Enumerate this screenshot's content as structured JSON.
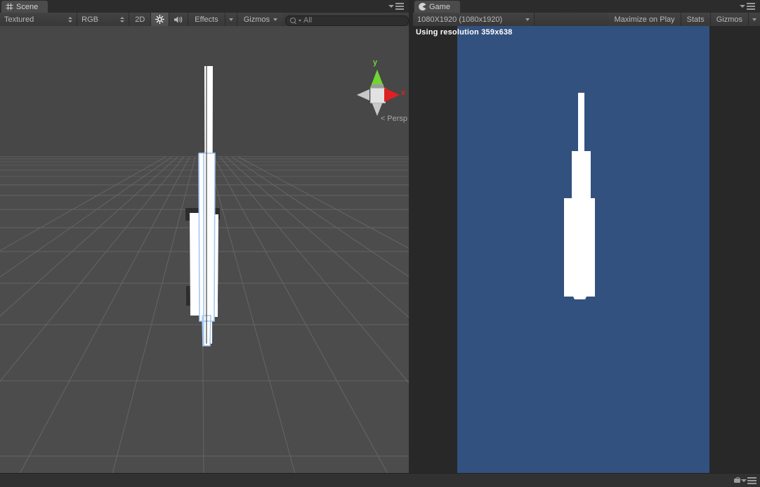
{
  "scene_panel": {
    "tab_label": "Scene",
    "tab_icon": "scene-grid-icon",
    "draw_mode": "Textured",
    "color_mode": "RGB",
    "toggle_2d": "2D",
    "lighting_icon": "sun-icon",
    "audio_icon": "speaker-icon",
    "effects_label": "Effects",
    "gizmos_label": "Gizmos",
    "search_placeholder": "All",
    "search_value": "",
    "gizmo": {
      "axis_y": "y",
      "axis_x": "x",
      "projection": "Persp"
    }
  },
  "game_panel": {
    "tab_label": "Game",
    "tab_icon": "game-pacman-icon",
    "resolution_option": "1080X1920 (1080x1920)",
    "maximize_label": "Maximize on Play",
    "stats_label": "Stats",
    "gizmos_label": "Gizmos",
    "overlay_text": "Using resolution 359x638",
    "background_color": "#33517e",
    "object_color": "#ffffff"
  },
  "status_bar": {
    "lock_icon": "lock-icon",
    "menu_icon": "hamburger-menu-icon"
  },
  "colors": {
    "panel_bg": "#393939",
    "toolbar_bg": "#3c3c3c",
    "scene_sky": "#474747",
    "scene_ground": "#4c4c4c",
    "grid_line": "#6e6e6e",
    "selection_outline": "#a6c8f0",
    "game_bg": "#33517e"
  }
}
